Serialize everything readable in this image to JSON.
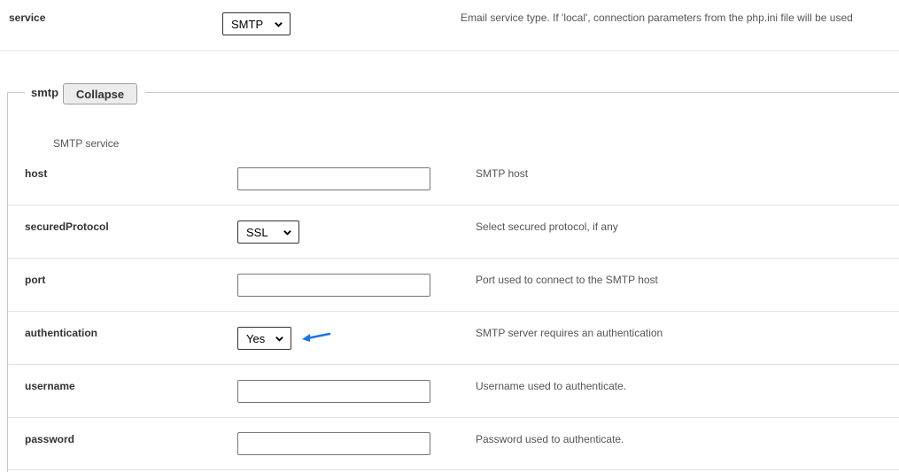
{
  "service": {
    "label": "service",
    "value": "SMTP",
    "description": "Email service type. If 'local', connection parameters from the php.ini file will be used"
  },
  "smtp": {
    "legend": "smtp",
    "collapse_label": "Collapse",
    "subtitle": "SMTP service",
    "host": {
      "label": "host",
      "value": "",
      "description": "SMTP host"
    },
    "securedProtocol": {
      "label": "securedProtocol",
      "value": "SSL",
      "description": "Select secured protocol, if any"
    },
    "port": {
      "label": "port",
      "value": "",
      "description": "Port used to connect to the SMTP host"
    },
    "authentication": {
      "label": "authentication",
      "value": "Yes",
      "description": "SMTP server requires an authentication"
    },
    "username": {
      "label": "username",
      "value": "",
      "description": "Username used to authenticate."
    },
    "password": {
      "label": "password",
      "value": "",
      "description": "Password used to authenticate."
    }
  },
  "colors": {
    "arrow": "#1a73e8",
    "divider": "#e3e3e3"
  },
  "icons": {
    "select_chevron": "chevron-down-icon",
    "annotation_arrow": "arrow-left-icon"
  }
}
